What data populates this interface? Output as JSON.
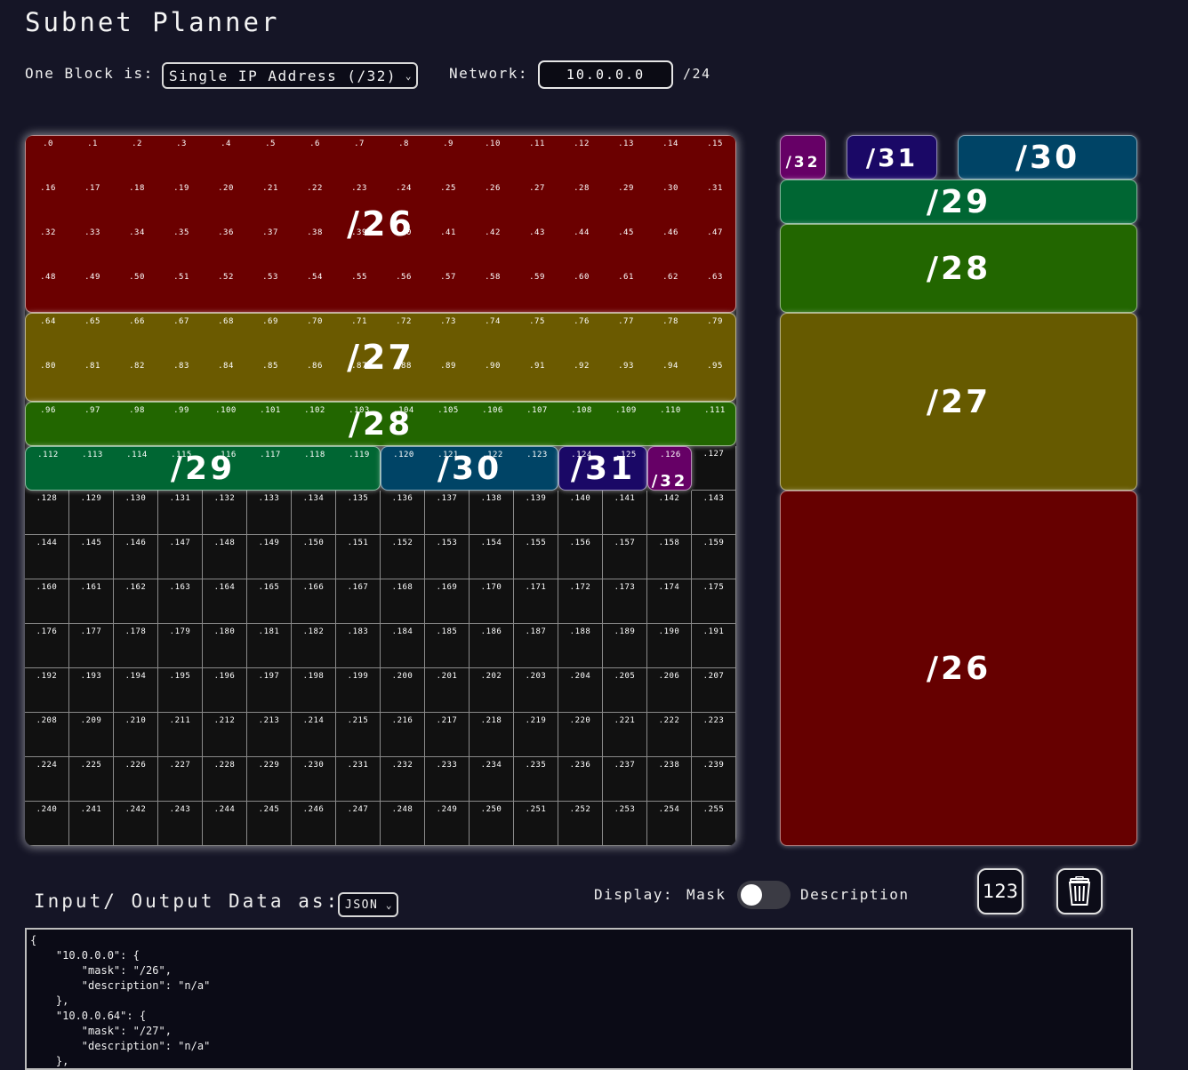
{
  "header": {
    "title": "Subnet Planner",
    "block_label": "One Block is:",
    "block_selected": "Single IP Address (/32)",
    "network_label": "Network:",
    "network_value": "10.0.0.0",
    "network_suffix": "/24"
  },
  "grid": {
    "ip_labels": [
      ".0",
      ".1",
      ".2",
      ".3",
      ".4",
      ".5",
      ".6",
      ".7",
      ".8",
      ".9",
      ".10",
      ".11",
      ".12",
      ".13",
      ".14",
      ".15",
      ".16",
      ".17",
      ".18",
      ".19",
      ".20",
      ".21",
      ".22",
      ".23",
      ".24",
      ".25",
      ".26",
      ".27",
      ".28",
      ".29",
      ".30",
      ".31",
      ".32",
      ".33",
      ".34",
      ".35",
      ".36",
      ".37",
      ".38",
      ".39",
      ".40",
      ".41",
      ".42",
      ".43",
      ".44",
      ".45",
      ".46",
      ".47",
      ".48",
      ".49",
      ".50",
      ".51",
      ".52",
      ".53",
      ".54",
      ".55",
      ".56",
      ".57",
      ".58",
      ".59",
      ".60",
      ".61",
      ".62",
      ".63",
      ".64",
      ".65",
      ".66",
      ".67",
      ".68",
      ".69",
      ".70",
      ".71",
      ".72",
      ".73",
      ".74",
      ".75",
      ".76",
      ".77",
      ".78",
      ".79",
      ".80",
      ".81",
      ".82",
      ".83",
      ".84",
      ".85",
      ".86",
      ".87",
      ".88",
      ".89",
      ".90",
      ".91",
      ".92",
      ".93",
      ".94",
      ".95",
      ".96",
      ".97",
      ".98",
      ".99",
      ".100",
      ".101",
      ".102",
      ".103",
      ".104",
      ".105",
      ".106",
      ".107",
      ".108",
      ".109",
      ".110",
      ".111",
      ".112",
      ".113",
      ".114",
      ".115",
      ".116",
      ".117",
      ".118",
      ".119",
      ".120",
      ".121",
      ".122",
      ".123",
      ".124",
      ".125",
      ".126",
      ".127",
      ".128",
      ".129",
      ".130",
      ".131",
      ".132",
      ".133",
      ".134",
      ".135",
      ".136",
      ".137",
      ".138",
      ".139",
      ".140",
      ".141",
      ".142",
      ".143",
      ".144",
      ".145",
      ".146",
      ".147",
      ".148",
      ".149",
      ".150",
      ".151",
      ".152",
      ".153",
      ".154",
      ".155",
      ".156",
      ".157",
      ".158",
      ".159",
      ".160",
      ".161",
      ".162",
      ".163",
      ".164",
      ".165",
      ".166",
      ".167",
      ".168",
      ".169",
      ".170",
      ".171",
      ".172",
      ".173",
      ".174",
      ".175",
      ".176",
      ".177",
      ".178",
      ".179",
      ".180",
      ".181",
      ".182",
      ".183",
      ".184",
      ".185",
      ".186",
      ".187",
      ".188",
      ".189",
      ".190",
      ".191",
      ".192",
      ".193",
      ".194",
      ".195",
      ".196",
      ".197",
      ".198",
      ".199",
      ".200",
      ".201",
      ".202",
      ".203",
      ".204",
      ".205",
      ".206",
      ".207",
      ".208",
      ".209",
      ".210",
      ".211",
      ".212",
      ".213",
      ".214",
      ".215",
      ".216",
      ".217",
      ".218",
      ".219",
      ".220",
      ".221",
      ".222",
      ".223",
      ".224",
      ".225",
      ".226",
      ".227",
      ".228",
      ".229",
      ".230",
      ".231",
      ".232",
      ".233",
      ".234",
      ".235",
      ".236",
      ".237",
      ".238",
      ".239",
      ".240",
      ".241",
      ".242",
      ".243",
      ".244",
      ".245",
      ".246",
      ".247",
      ".248",
      ".249",
      ".250",
      ".251",
      ".252",
      ".253",
      ".254",
      ".255"
    ],
    "allocations": [
      {
        "label": "/26",
        "start": 0,
        "size": 64,
        "color": "#6b0000"
      },
      {
        "label": "/27",
        "start": 64,
        "size": 32,
        "color": "#6b5a00"
      },
      {
        "label": "/28",
        "start": 96,
        "size": 16,
        "color": "#226600"
      },
      {
        "label": "/29",
        "start": 112,
        "size": 8,
        "color": "#006633"
      },
      {
        "label": "/30",
        "start": 120,
        "size": 4,
        "color": "#004466"
      },
      {
        "label": "/31",
        "start": 124,
        "size": 2,
        "color": "#1a0866"
      },
      {
        "label": "/32",
        "start": 126,
        "size": 1,
        "color": "#660066"
      }
    ]
  },
  "legend": [
    {
      "label": "/32",
      "color": "#660066"
    },
    {
      "label": "/31",
      "color": "#1a0866"
    },
    {
      "label": "/30",
      "color": "#004466"
    },
    {
      "label": "/29",
      "color": "#006633"
    },
    {
      "label": "/28",
      "color": "#226600"
    },
    {
      "label": "/27",
      "color": "#665a00"
    },
    {
      "label": "/26",
      "color": "#660000"
    }
  ],
  "io": {
    "label": "Input/ Output Data as:",
    "format_selected": "JSON",
    "display_label": "Display:",
    "mask_label": "Mask",
    "description_label": "Description",
    "toggle_on": false,
    "numbers_button": "123",
    "trash_icon": "trash-icon",
    "json_text": "{\n    \"10.0.0.0\": {\n        \"mask\": \"/26\",\n        \"description\": \"n/a\"\n    },\n    \"10.0.0.64\": {\n        \"mask\": \"/27\",\n        \"description\": \"n/a\"\n    },\n    }"
  }
}
